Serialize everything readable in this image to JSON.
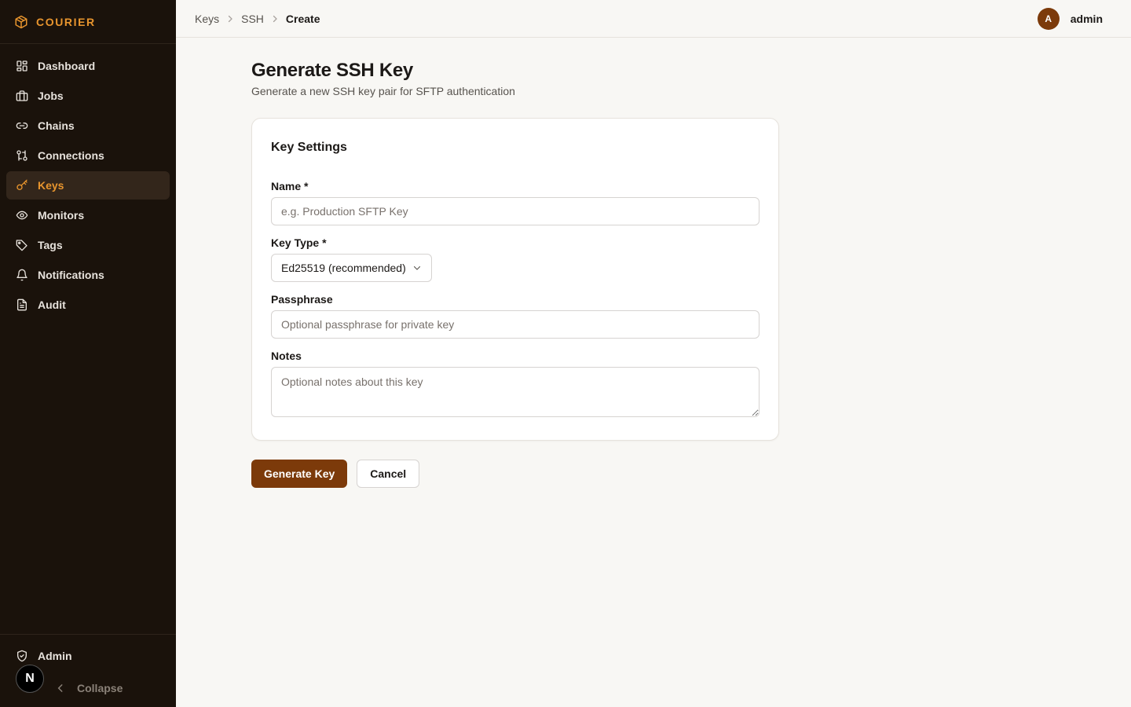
{
  "app": {
    "brand": "COURIER"
  },
  "colors": {
    "accent": "#e8952e",
    "primary": "#7c3a0a",
    "sidebar_bg": "#1a120b",
    "active_bg": "#33261b"
  },
  "sidebar": {
    "items": [
      {
        "label": "Dashboard",
        "icon": "dashboard-icon"
      },
      {
        "label": "Jobs",
        "icon": "briefcase-icon"
      },
      {
        "label": "Chains",
        "icon": "link-icon"
      },
      {
        "label": "Connections",
        "icon": "connections-icon"
      },
      {
        "label": "Keys",
        "icon": "key-icon",
        "active": true
      },
      {
        "label": "Monitors",
        "icon": "eye-icon"
      },
      {
        "label": "Tags",
        "icon": "tag-icon"
      },
      {
        "label": "Notifications",
        "icon": "bell-icon"
      },
      {
        "label": "Audit",
        "icon": "document-icon"
      }
    ],
    "footer": {
      "admin_label": "Admin",
      "collapse_label": "Collapse",
      "badge": "N"
    }
  },
  "breadcrumb": {
    "items": [
      "Keys",
      "SSH"
    ],
    "current": "Create"
  },
  "user": {
    "initial": "A",
    "name": "admin"
  },
  "page": {
    "title": "Generate SSH Key",
    "subtitle": "Generate a new SSH key pair for SFTP authentication"
  },
  "form": {
    "section_title": "Key Settings",
    "name": {
      "label": "Name *",
      "placeholder": "e.g. Production SFTP Key",
      "value": ""
    },
    "key_type": {
      "label": "Key Type *",
      "selected": "Ed25519 (recommended)"
    },
    "passphrase": {
      "label": "Passphrase",
      "placeholder": "Optional passphrase for private key",
      "value": ""
    },
    "notes": {
      "label": "Notes",
      "placeholder": "Optional notes about this key",
      "value": ""
    },
    "submit_label": "Generate Key",
    "cancel_label": "Cancel"
  }
}
